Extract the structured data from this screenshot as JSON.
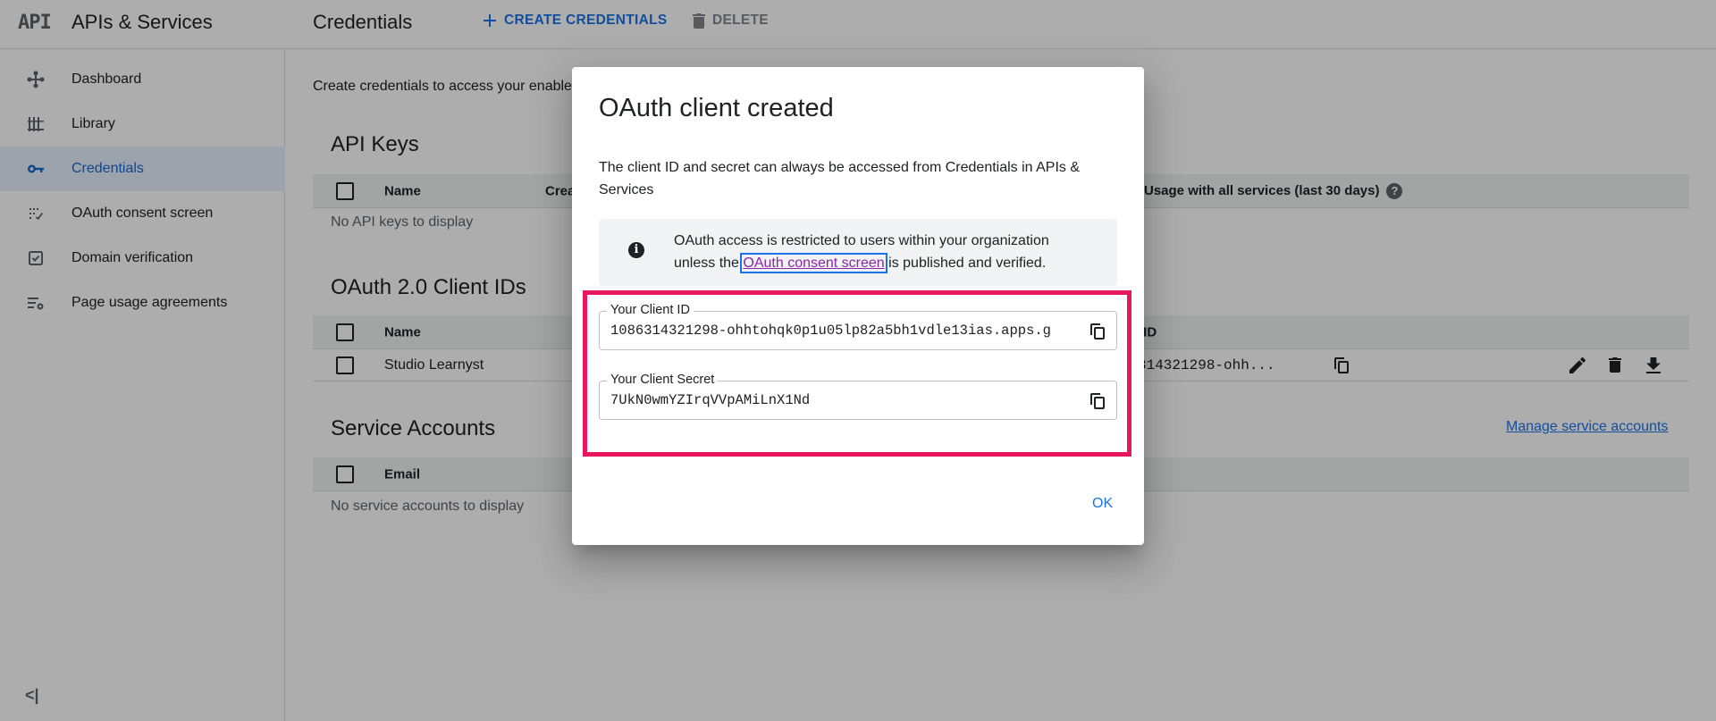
{
  "header": {
    "logo_text": "API",
    "app_title": "APIs & Services",
    "page_title": "Credentials",
    "create_label": "CREATE CREDENTIALS",
    "delete_label": "DELETE"
  },
  "sidebar": {
    "items": [
      {
        "label": "Dashboard",
        "icon": "dashboard-icon"
      },
      {
        "label": "Library",
        "icon": "library-icon"
      },
      {
        "label": "Credentials",
        "icon": "key-icon",
        "active": true
      },
      {
        "label": "OAuth consent screen",
        "icon": "consent-screen-icon"
      },
      {
        "label": "Domain verification",
        "icon": "checkbox-icon"
      },
      {
        "label": "Page usage agreements",
        "icon": "settings-list-icon"
      }
    ],
    "collapse_label": "<|"
  },
  "main": {
    "intro": "Create credentials to access your enable",
    "api_keys": {
      "title": "API Keys",
      "columns": [
        "Name",
        "Crea",
        "Usage with all services (last 30 days)"
      ],
      "empty": "No API keys to display"
    },
    "oauth": {
      "title": "OAuth 2.0 Client IDs",
      "columns": [
        "Name",
        "t ID"
      ],
      "rows": [
        {
          "name": "Studio Learnyst",
          "client_id_partial": "314321298-ohh..."
        }
      ]
    },
    "service_accounts": {
      "title": "Service Accounts",
      "columns": [
        "Email"
      ],
      "empty": "No service accounts to display",
      "manage_link": "Manage service accounts"
    }
  },
  "dialog": {
    "title": "OAuth client created",
    "description": "The client ID and secret can always be accessed from Credentials in APIs & Services",
    "info_prefix": "OAuth access is restricted to users within your organization unless the ",
    "info_link": "OAuth consent screen",
    "info_suffix": " is published and verified.",
    "client_id_label": "Your Client ID",
    "client_id_value": "1086314321298-ohhtohqk0p1u05lp82a5bh1vdle13ias.apps.g",
    "client_secret_label": "Your Client Secret",
    "client_secret_value": "7UkN0wmYZIrqVVpAMiLnX1Nd",
    "ok_label": "OK"
  },
  "colors": {
    "accent": "#1a73e8",
    "highlight": "#e8175d",
    "active_nav_bg": "#e8f0fe"
  }
}
